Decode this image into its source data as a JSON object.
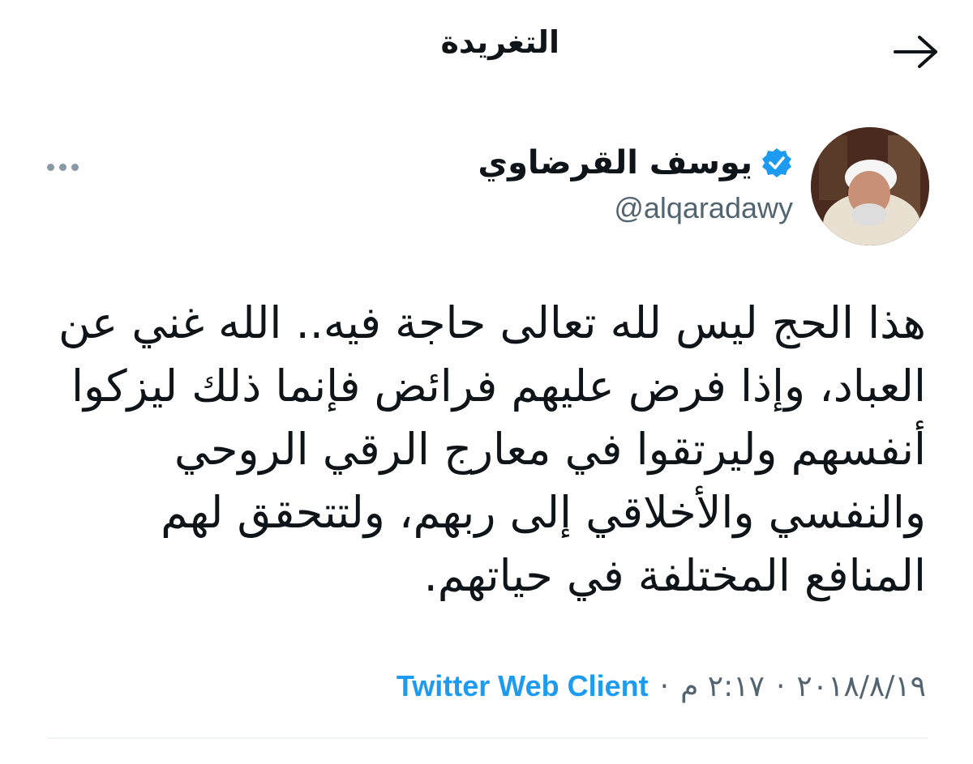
{
  "header": {
    "title": "التغريدة",
    "back_icon": "arrow-right-icon"
  },
  "tweet": {
    "author": {
      "display_name": "يوسف القرضاوي",
      "handle": "@alqaradawy",
      "verified": true
    },
    "more_icon": "more-dots-icon",
    "text": "هذا الحج ليس لله تعالى حاجة فيه.. الله غني عن العباد، وإذا فرض عليهم فرائض فإنما ذلك ليزكوا أنفسهم وليرتقوا في معارج الرقي الروحي والنفسي والأخلاقي إلى ربهم، ولتتحقق لهم المنافع المختلفة في حياتهم.",
    "date": "٢٠١٨/٨/١٩",
    "time": "٢:١٧ م",
    "separator": "·",
    "source": "Twitter Web Client"
  },
  "colors": {
    "accent": "#1d9bf0",
    "text": "#0f1419",
    "secondary": "#536471"
  }
}
